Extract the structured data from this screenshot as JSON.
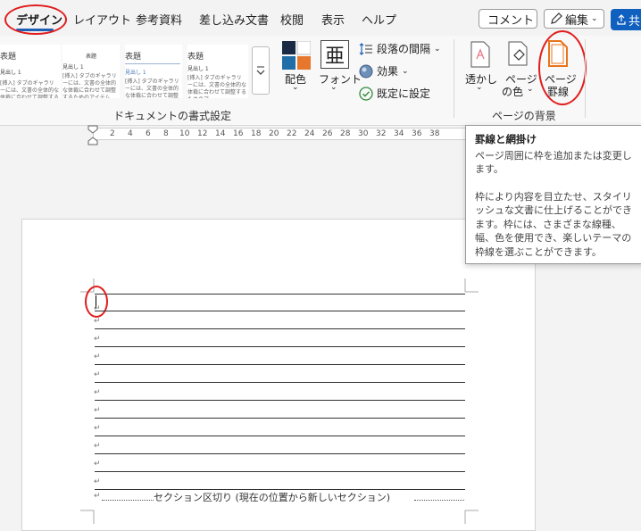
{
  "tabs": [
    {
      "label": "デザイン",
      "active": true
    },
    {
      "label": "レイアウト"
    },
    {
      "label": "参考資料"
    },
    {
      "label": "差し込み文書"
    },
    {
      "label": "校閲"
    },
    {
      "label": "表示"
    },
    {
      "label": "ヘルプ"
    }
  ],
  "top_right": {
    "comment": "コメント",
    "edit": "編集",
    "share": "共"
  },
  "styles_gallery": {
    "items": [
      {
        "title": "表題",
        "h1": "見出し 1",
        "body": "[挿入] タブのギャラリーには、文書の全体的な体裁に合わせて調整するためのアイテムが含まれています"
      },
      {
        "title": "表題",
        "h1": "見出し 1",
        "body": "[挿入] タブのギャラリーには、文書の全体的な体裁に合わせて調整するためのアイテム"
      },
      {
        "title": "表題",
        "h1": "見出し 1",
        "body": "[挿入] タブのギャラリーには、文書の全体的な体裁に合わせて調整するためのアイ"
      },
      {
        "title": "表題",
        "h1": "見出し 1",
        "body": "[挿入] タブのギャラリーには、文書の全体的な体裁に合わせて調整するためのア"
      }
    ],
    "group_label": "ドキュメントの書式設定"
  },
  "format_buttons": {
    "colors": "配色",
    "fonts": "フォント",
    "fonts_glyph": "亜",
    "paragraph_spacing": "段落の間隔",
    "effects": "効果",
    "set_default": "既定に設定"
  },
  "page_background": {
    "watermark": "透かし",
    "page_color_1": "ページ",
    "page_color_2": "の色",
    "page_borders_1": "ページ",
    "page_borders_2": "罫線",
    "group_label": "ページの背景"
  },
  "ruler_ticks": [
    "2",
    "4",
    "6",
    "8",
    "10",
    "12",
    "14",
    "16",
    "18",
    "20",
    "22",
    "24",
    "26",
    "28",
    "30",
    "32",
    "34",
    "36",
    "38"
  ],
  "tooltip": {
    "title": "罫線と網掛け",
    "line1": "ページ周囲に枠を追加または変更します。",
    "line2": "枠により内容を目立たせ、スタイリッシュな文書に仕上げることができます。枠には、さまざまな線種、幅、色を使用でき、楽しいテーマの枠線を選ぶことができます。"
  },
  "document": {
    "paragraph_mark": "↵",
    "section_break": "セクション区切り (現在の位置から新しいセクション)"
  },
  "colors": {
    "accent": "#1e5fb4",
    "highlight_circle": "#e01d1d",
    "page_border_icon": "#e8741c"
  }
}
